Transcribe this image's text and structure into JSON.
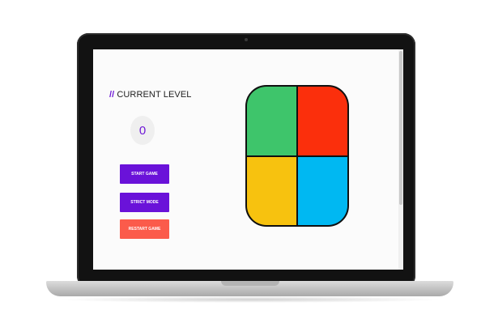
{
  "header": {
    "title_prefix": "//",
    "title": "CURRENT LEVEL"
  },
  "level": {
    "value": "0"
  },
  "buttons": {
    "start": "START GAME",
    "strict": "STRICT MODE",
    "restart": "RESTART GAME"
  },
  "colors": {
    "accent": "#6a12d9",
    "restart": "#fb5b4b",
    "pad_green": "#3ec56b",
    "pad_red": "#fb2f0c",
    "pad_yellow": "#f7c20f",
    "pad_blue": "#00b8f2"
  },
  "icons": {
    "camera": "webcam-icon"
  }
}
